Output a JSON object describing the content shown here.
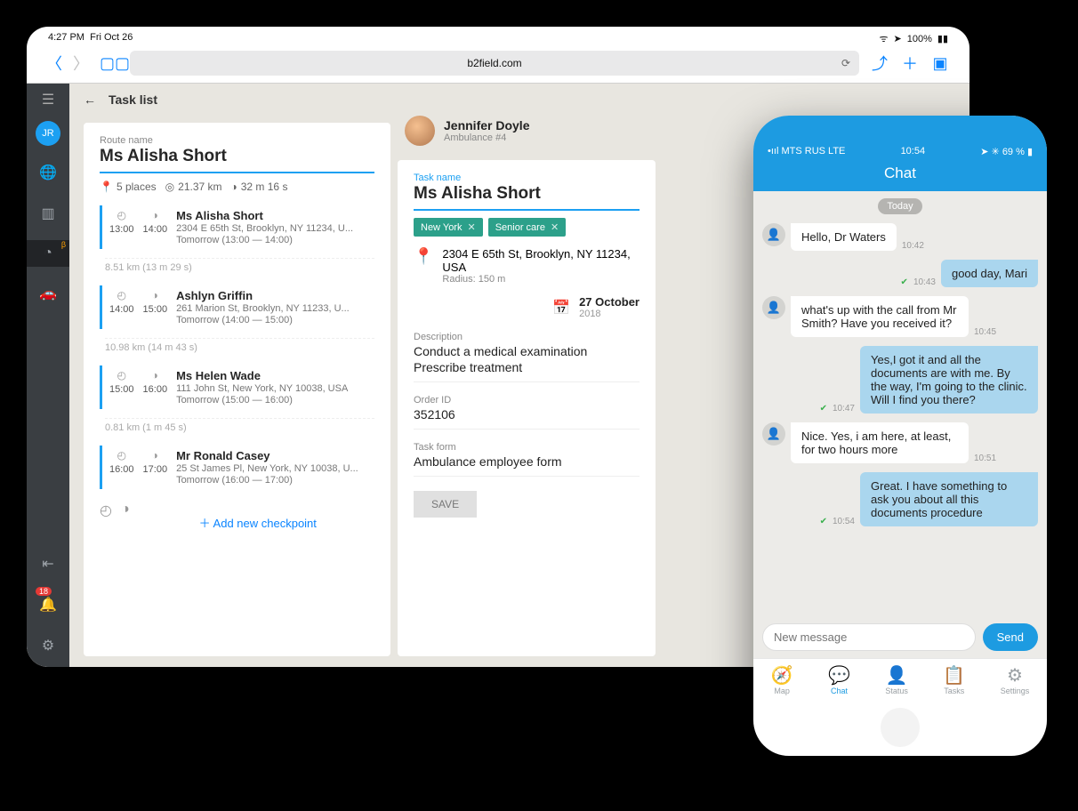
{
  "tablet": {
    "status": {
      "time": "4:27 PM",
      "date": "Fri Oct 26",
      "battery": "100%"
    },
    "url": "b2field.com",
    "sidebar": {
      "avatar": "JR",
      "notifications": "18",
      "beta": "β"
    },
    "taskList": {
      "title": "Task list",
      "routeLabel": "Route name",
      "routeName": "Ms Alisha Short",
      "stats": {
        "places": "5 places",
        "distance": "21.37 km",
        "duration": "32 m 16 s"
      },
      "checkpoints": [
        {
          "from": "13:00",
          "to": "14:00",
          "name": "Ms Alisha Short",
          "addr": "2304 E 65th St, Brooklyn, NY 11234, U...",
          "when": "Tomorrow (13:00 — 14:00)"
        },
        {
          "from": "14:00",
          "to": "15:00",
          "name": "Ashlyn Griffin",
          "addr": "261 Marion St, Brooklyn, NY 11233, U...",
          "when": "Tomorrow (14:00 — 15:00)"
        },
        {
          "from": "15:00",
          "to": "16:00",
          "name": "Ms Helen Wade",
          "addr": "111 John St, New York, NY 10038, USA",
          "when": "Tomorrow (15:00 — 16:00)"
        },
        {
          "from": "16:00",
          "to": "17:00",
          "name": "Mr Ronald Casey",
          "addr": "25 St James Pl, New York, NY 10038, U...",
          "when": "Tomorrow (16:00 — 17:00)"
        }
      ],
      "gaps": [
        "8.51 km (13 m 29 s)",
        "10.98 km (14 m 43 s)",
        "0.81 km (1 m 45 s)"
      ],
      "addCheckpoint": "Add new checkpoint"
    },
    "detail": {
      "assignee": {
        "name": "Jennifer Doyle",
        "sub": "Ambulance #4"
      },
      "taskLabel": "Task name",
      "taskName": "Ms Alisha Short",
      "tags": [
        "New York",
        "Senior care"
      ],
      "address": "2304 E 65th St, Brooklyn, NY 11234, USA",
      "radius": "Radius: 150 m",
      "date": "27 October",
      "year": "2018",
      "descLabel": "Description",
      "desc1": "Conduct a medical examination",
      "desc2": "Prescribe treatment",
      "orderLabel": "Order ID",
      "order": "352106",
      "formLabel": "Task form",
      "form": "Ambulance employee form",
      "save": "SAVE"
    }
  },
  "phone": {
    "status": {
      "carrier": "MTS RUS   LTE",
      "time": "10:54",
      "right": "69 %"
    },
    "title": "Chat",
    "today": "Today",
    "messages": [
      {
        "dir": "in",
        "text": "Hello, Dr Waters",
        "ts": "10:42"
      },
      {
        "dir": "out",
        "text": "good day, Mari",
        "ts": "10:43"
      },
      {
        "dir": "in",
        "text": "what's up with the call from Mr Smith? Have you received it?",
        "ts": "10:45"
      },
      {
        "dir": "out",
        "text": "Yes,I got it and all the documents are with me. By the way, I'm going to the clinic. Will I find you there?",
        "ts": "10:47"
      },
      {
        "dir": "in",
        "text": "Nice. Yes, i am here, at least, for two hours more",
        "ts": "10:51"
      },
      {
        "dir": "out",
        "text": "Great. I have something to ask you about all this documents procedure",
        "ts": "10:54"
      }
    ],
    "placeholder": "New message",
    "send": "Send",
    "tabs": [
      {
        "icon": "🧭",
        "label": "Map"
      },
      {
        "icon": "💬",
        "label": "Chat"
      },
      {
        "icon": "👤",
        "label": "Status"
      },
      {
        "icon": "📋",
        "label": "Tasks"
      },
      {
        "icon": "⚙",
        "label": "Settings"
      }
    ]
  }
}
